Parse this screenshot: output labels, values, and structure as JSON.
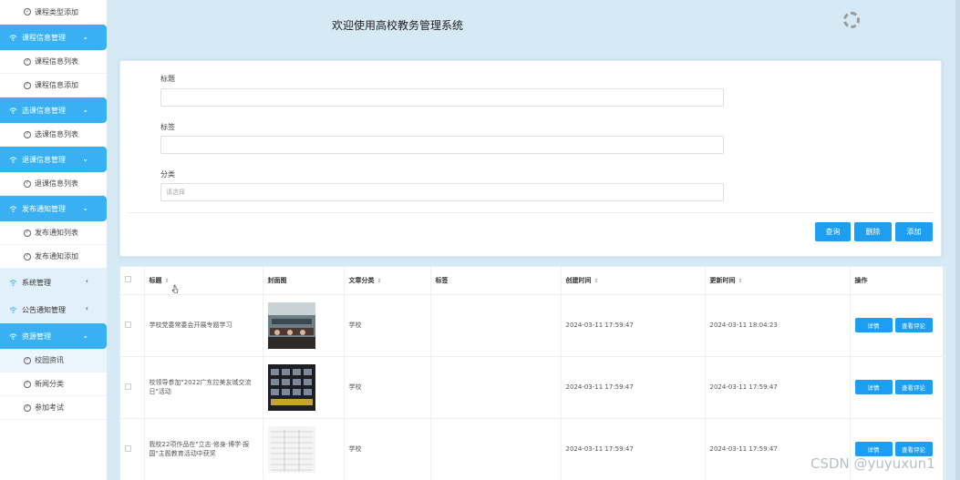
{
  "header": {
    "title": "欢迎使用高校教务管理系统"
  },
  "sidebar": {
    "items": [
      {
        "type": "sub",
        "label": "课程类型添加"
      },
      {
        "type": "group",
        "label": "课程信息管理",
        "expanded": true
      },
      {
        "type": "sub",
        "label": "课程信息列表"
      },
      {
        "type": "sub",
        "label": "课程信息添加"
      },
      {
        "type": "group",
        "label": "选课信息管理",
        "expanded": true
      },
      {
        "type": "sub",
        "label": "选课信息列表"
      },
      {
        "type": "group",
        "label": "退课信息管理",
        "expanded": true
      },
      {
        "type": "sub",
        "label": "退课信息列表"
      },
      {
        "type": "group",
        "label": "发布通知管理",
        "expanded": true
      },
      {
        "type": "sub",
        "label": "发布通知列表"
      },
      {
        "type": "sub",
        "label": "发布通知添加"
      },
      {
        "type": "group",
        "label": "系统管理",
        "expanded": false
      },
      {
        "type": "group",
        "label": "公告通知管理",
        "expanded": false
      },
      {
        "type": "group",
        "label": "资源管理",
        "expanded": true
      },
      {
        "type": "sub",
        "label": "校园资讯",
        "highlight": true
      },
      {
        "type": "sub",
        "label": "新闻分类"
      },
      {
        "type": "sub",
        "label": "参加考试"
      }
    ]
  },
  "form": {
    "title_label": "标题",
    "title_value": "",
    "tag_label": "标签",
    "tag_value": "",
    "category_label": "分类",
    "category_placeholder": "请选择",
    "search_button": "查询",
    "delete_button": "删除",
    "add_button": "添加"
  },
  "table": {
    "columns": [
      "标题",
      "封面图",
      "文章分类",
      "标签",
      "创建时间",
      "更新时间",
      "操作"
    ],
    "rows": [
      {
        "title": "学校党委常委会开展专题学习",
        "category": "学校",
        "tag": "",
        "created": "2024-03-11 17:59:47",
        "updated": "2024-03-11 18:04:23",
        "detail": "详情",
        "comments": "查看评论"
      },
      {
        "title": "校领导参加\"2022广东拉美友城交流日\"活动",
        "category": "学校",
        "tag": "",
        "created": "2024-03-11 17:59:47",
        "updated": "2024-03-11 17:59:47",
        "detail": "详情",
        "comments": "查看评论"
      },
      {
        "title": "我校22项作品在\"立志·修身·博学·报国\"主题教育活动中获奖",
        "category": "学校",
        "tag": "",
        "created": "2024-03-11 17:59:47",
        "updated": "2024-03-11 17:59:47",
        "detail": "详情",
        "comments": "查看评论"
      }
    ]
  },
  "watermark": "CSDN @yuyuxun1",
  "colors": {
    "primary": "#1e9ef0",
    "sidebar_active": "#38b0f2",
    "background": "#d6eaf6"
  }
}
